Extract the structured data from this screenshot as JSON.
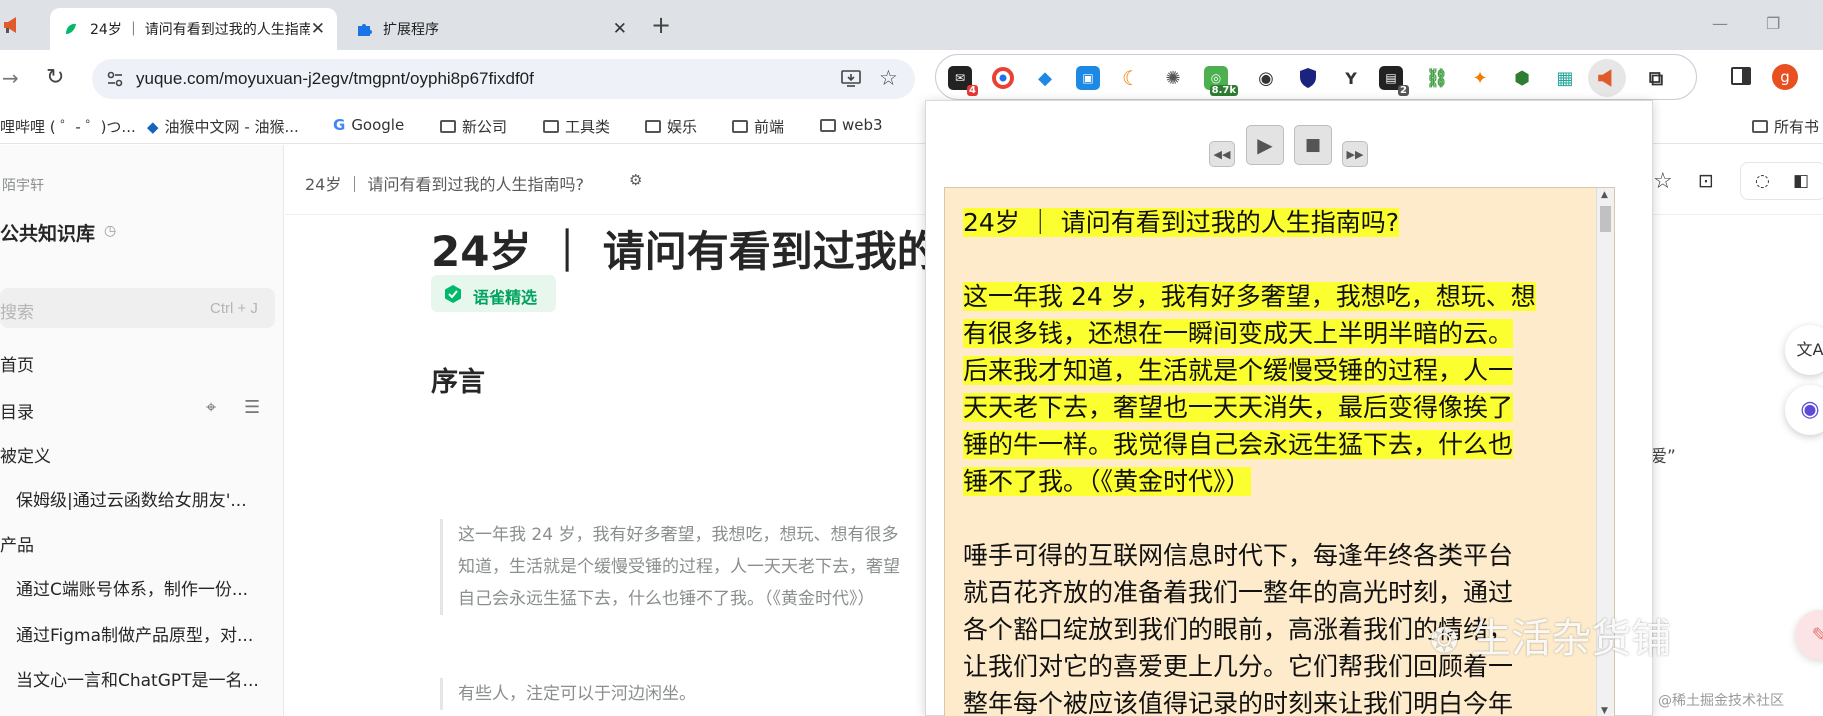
{
  "tabs": [
    {
      "title": "24岁 ｜ 请问有看到过我的人生指南吗?",
      "active": true
    },
    {
      "title": "扩展程序",
      "active": false
    }
  ],
  "toolbar": {
    "url": "yuque.com/moyuxuan-j2egv/tmgpnt/oyphi8p67fixdf0f",
    "badges": {
      "mail": "4",
      "eight_k": "8.7k",
      "two": "2"
    },
    "profile_initial": "g"
  },
  "bookmarks": [
    "哩哔哩 ( ゜- ゜)つ...",
    "油猴中文网 - 油猴...",
    "Google",
    "新公司",
    "工具类",
    "娱乐",
    "前端",
    "web3",
    "所有书"
  ],
  "sidebar": {
    "author": "陌宇轩",
    "repo": "公共知识库",
    "search_placeholder": "搜索",
    "search_shortcut": "Ctrl + J",
    "home": "首页",
    "toc": "目录",
    "items": [
      "被定义",
      "保姆级|通过云函数给女朋友'...",
      "产品",
      "通过C端账号体系，制作一份...",
      "通过Figma制做产品原型，对...",
      "当文心一言和ChatGPT是一名..."
    ]
  },
  "doc": {
    "breadcrumb": "24岁 ｜ 请问有看到过我的人生指南吗?",
    "title": "24岁 ｜ 请问有看到过我的",
    "badge": "语雀精选",
    "section": "序言",
    "quote_lines": [
      "这一年我 24 岁，我有好多奢望，我想吃，想玩、想有很多",
      "知道，生活就是个缓慢受锤的过程，人一天天老下去，奢望",
      "自己会永远生猛下去，什么也锤不了我。（《黄金时代》）"
    ],
    "quote2": "有些人，注定可以于河边闲坐。",
    "right_fragment": "爱”"
  },
  "reader": {
    "title": "24岁 ｜ 请问有看到过我的人生指南吗?",
    "p1_lines": [
      "这一年我 24 岁，我有好多奢望，我想吃，想玩、想",
      "有很多钱，还想在一瞬间变成天上半明半暗的云。",
      "后来我才知道，生活就是个缓慢受锤的过程，人一",
      "天天老下去，奢望也一天天消失，最后变得像挨了",
      "锤的牛一样。我觉得自己会永远生猛下去，什么也",
      "锤不了我。（《黄金时代》）"
    ],
    "p2_lines": [
      "唾手可得的互联网信息时代下，每逢年终各类平台",
      "就百花齐放的准备着我们一整年的高光时刻，通过",
      "各个豁口绽放到我们的眼前，高涨着我们的情绪，",
      "让我们对它的喜爱更上几分。它们帮我们回顾着一",
      "整年每个被应该值得记录的时刻来让我们明白今年"
    ]
  },
  "watermark": "生活杂货铺",
  "watermark_small": "@稀土掘金技术社区",
  "colors": {
    "highlight": "#fcff2f",
    "reader_bg": "#fdebcb",
    "yuque_green": "#00b96b"
  }
}
